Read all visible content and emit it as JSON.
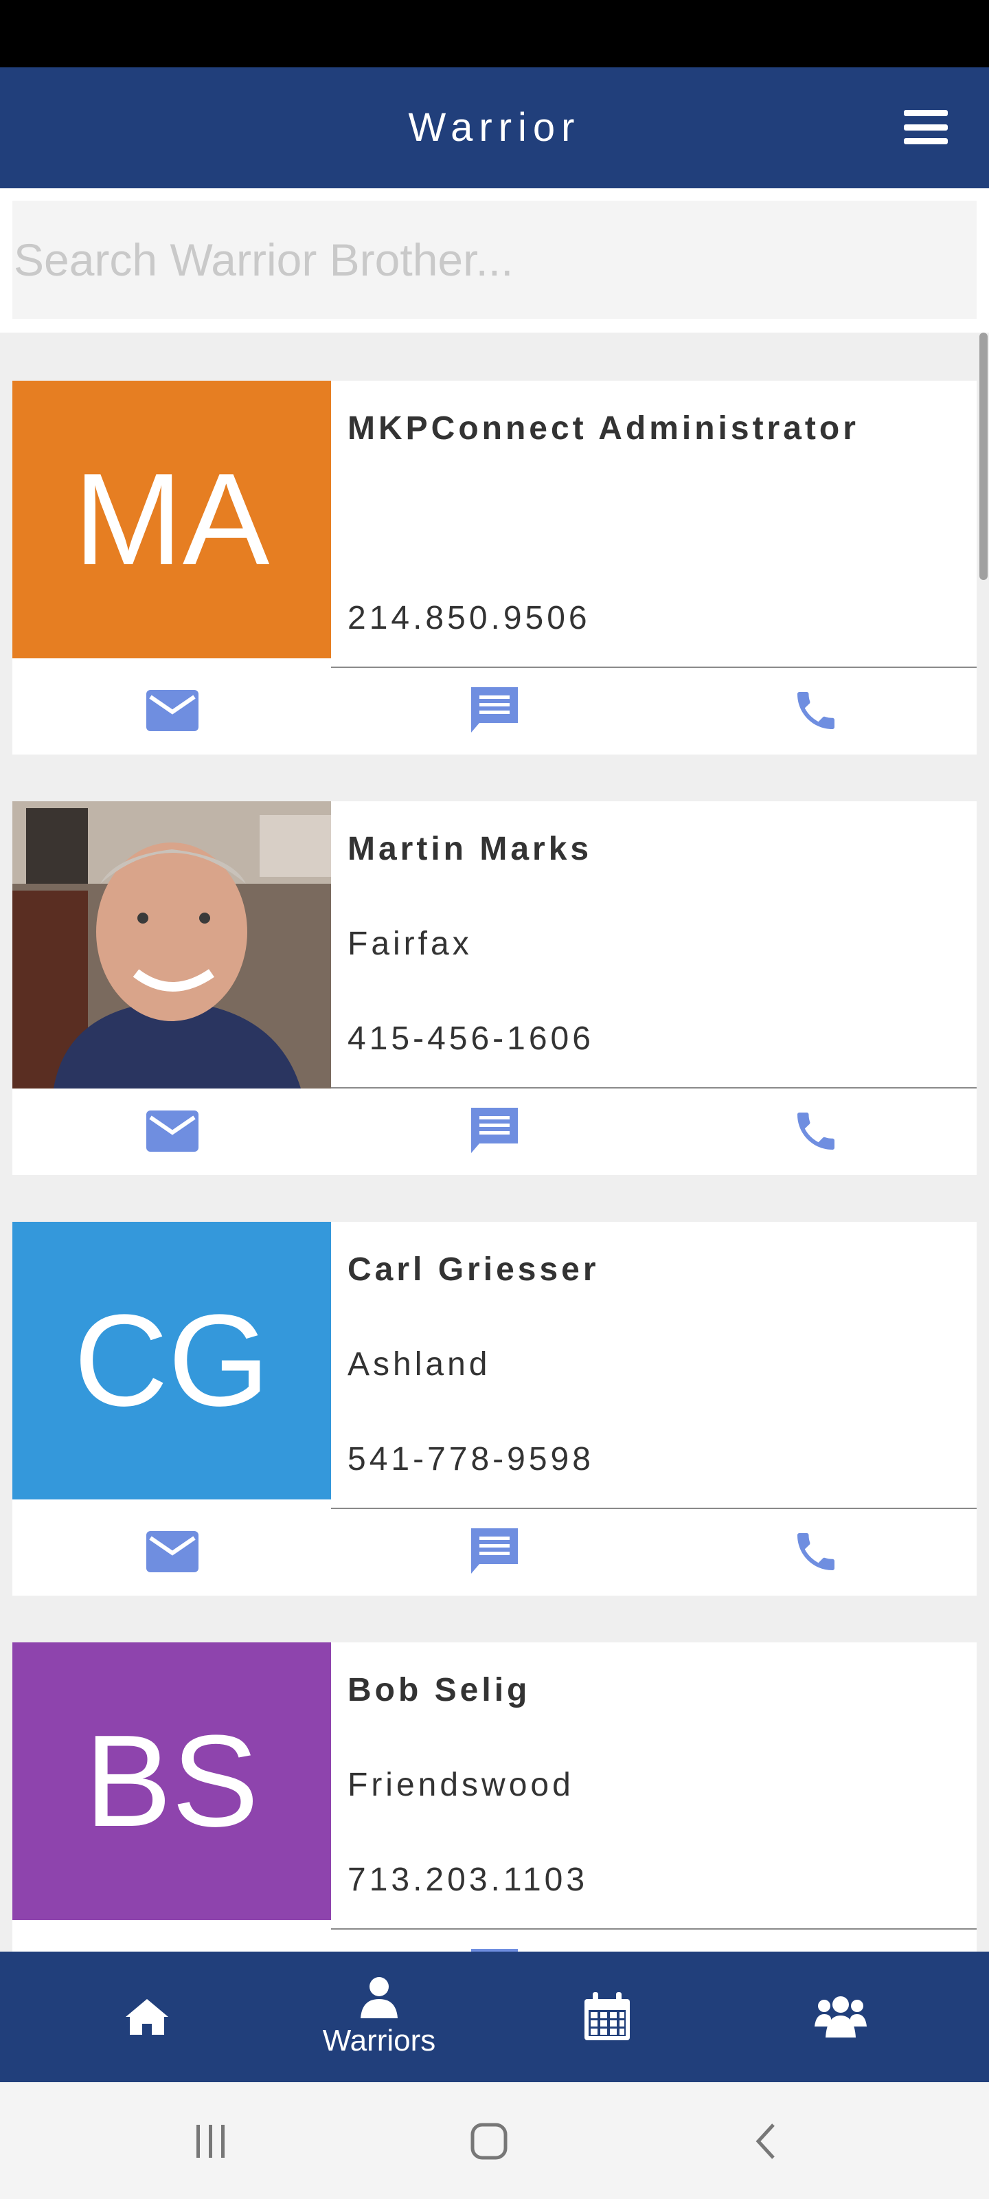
{
  "header": {
    "title": "Warrior"
  },
  "search": {
    "placeholder": "Search Warrior Brother...",
    "value": ""
  },
  "contacts": [
    {
      "initials": "MA",
      "name": "MKPConnect Administrator",
      "city": "",
      "phone": "214.850.9506",
      "avatar_color": "#e67e22",
      "has_photo": false
    },
    {
      "initials": "",
      "name": "Martin Marks",
      "city": "Fairfax",
      "phone": "415-456-1606",
      "avatar_color": "#6b5a4e",
      "has_photo": true
    },
    {
      "initials": "CG",
      "name": "Carl Griesser",
      "city": "Ashland",
      "phone": "541-778-9598",
      "avatar_color": "#3498db",
      "has_photo": false
    },
    {
      "initials": "BS",
      "name": "Bob Selig",
      "city": "Friendswood",
      "phone": "713.203.1103",
      "avatar_color": "#8e44ad",
      "has_photo": false
    }
  ],
  "action_icons": [
    "email-icon",
    "message-icon",
    "phone-icon"
  ],
  "bottom_nav": {
    "items": [
      {
        "icon": "home-icon",
        "label": ""
      },
      {
        "icon": "user-icon",
        "label": "Warriors"
      },
      {
        "icon": "calendar-icon",
        "label": ""
      },
      {
        "icon": "group-icon",
        "label": ""
      }
    ]
  },
  "colors": {
    "primary": "#213f7b",
    "action_icon": "#6f8ee0",
    "background": "#efefef"
  }
}
